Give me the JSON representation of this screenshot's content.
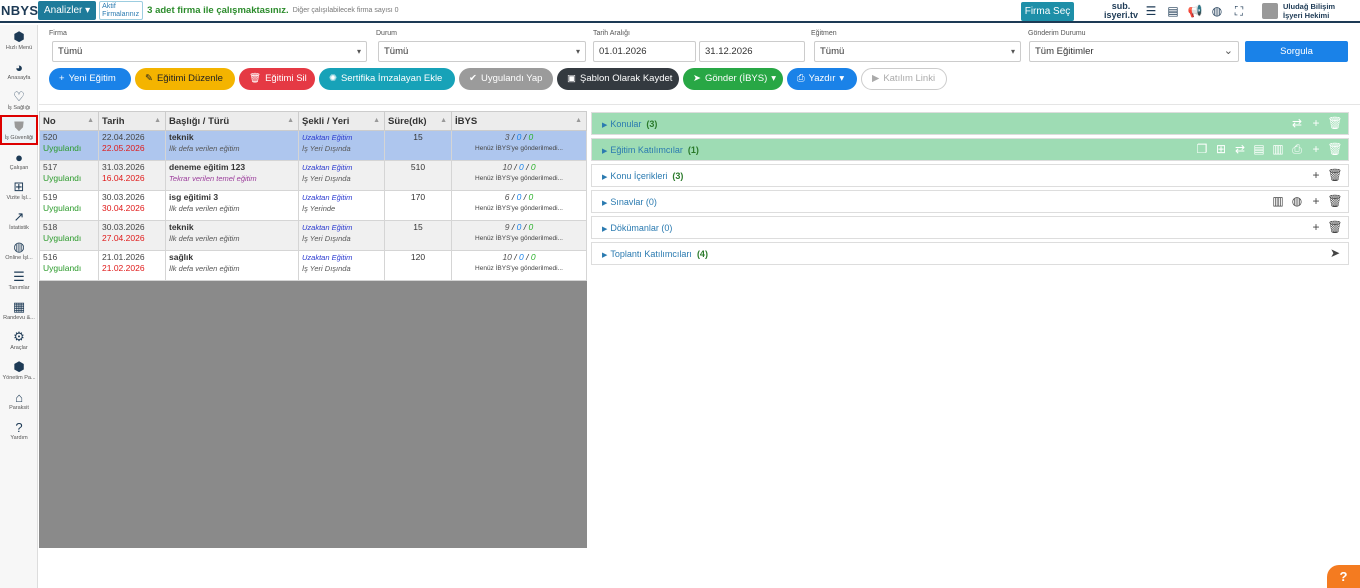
{
  "topbar": {
    "logo": "NBYS",
    "analiz_label": "Analizler",
    "aktif_label": "Aktif Firmalarınız",
    "firm_msg": "3 adet firma ile çalışmaktasınız.",
    "firm_msg2": "Diğer çalışılabilecek firma sayısı 0",
    "firma_sec": "Firma Seç",
    "sub_logo": "sub. isyeri.tv",
    "user_name": "Uludağ Bilişim",
    "user_role": "İşyeri Hekimi"
  },
  "sidebar": {
    "items": [
      {
        "label": "Hızlı Menü",
        "icon": "boxes-icon"
      },
      {
        "label": "Anasayfa",
        "icon": "pie-chart-icon"
      },
      {
        "label": "İş Sağlığı",
        "icon": "heartbeat-icon"
      },
      {
        "label": "İş Güvenliği",
        "icon": "shield-icon"
      },
      {
        "label": "Çalışan",
        "icon": "person-icon"
      },
      {
        "label": "Vizite İşl...",
        "icon": "medical-case-icon"
      },
      {
        "label": "İstatistik",
        "icon": "line-chart-icon"
      },
      {
        "label": "Online İşl...",
        "icon": "globe-icon"
      },
      {
        "label": "Tanımlar",
        "icon": "sliders-icon"
      },
      {
        "label": "Randevu &...",
        "icon": "calendar-icon"
      },
      {
        "label": "Araçlar",
        "icon": "gears-icon"
      },
      {
        "label": "Yönetim Pa...",
        "icon": "boxes-icon"
      },
      {
        "label": "Paraksit",
        "icon": "bank-icon"
      },
      {
        "label": "Yardım",
        "icon": "question-icon"
      }
    ]
  },
  "filters": {
    "firma_label": "Firma",
    "firma_value": "Tümü",
    "durum_label": "Durum",
    "durum_value": "Tümü",
    "tarih_label": "Tarih Aralığı",
    "tarih_start": "01.01.2026",
    "tarih_end": "31.12.2026",
    "egitmen_label": "Eğitmen",
    "egitmen_value": "Tümü",
    "gonderim_label": "Gönderim Durumu",
    "gonderim_value": "Tüm Eğitimler",
    "sorgula": "Sorgula"
  },
  "buttons": {
    "yeni": "Yeni Eğitim",
    "duzenle": "Eğitimi Düzenle",
    "sil": "Eğitimi Sil",
    "sertifika": "Sertifika İmzalayan Ekle",
    "uygulandi": "Uygulandı Yap",
    "sablon": "Şablon Olarak Kaydet",
    "gonder": "Gönder (İBYS)",
    "yazdir": "Yazdır",
    "katilim": "Katılım Linki"
  },
  "table": {
    "headers": [
      "No",
      "Tarih",
      "Başlığı / Türü",
      "Şekli / Yeri",
      "Süre(dk)",
      "İBYS"
    ],
    "rows": [
      {
        "no": "520",
        "status": "Uygulandı",
        "d1": "22.04.2026",
        "d2": "22.05.2026",
        "title": "teknik",
        "type": "İlk defa verilen eğitim",
        "sekil": "Uzaktan Eğitim",
        "yer": "İş Yeri Dışında",
        "sure": "15",
        "i1": "3",
        "i2": "0",
        "i3": "0",
        "ibys_note": "Henüz İBYS'ye gönderilmedi..."
      },
      {
        "no": "517",
        "status": "Uygulandı",
        "d1": "31.03.2026",
        "d2": "16.04.2026",
        "title": "deneme eğitim 123",
        "type": "Tekrar verilen temel eğitim",
        "sekil": "Uzaktan Eğitim",
        "yer": "İş Yeri Dışında",
        "sure": "510",
        "i1": "10",
        "i2": "0",
        "i3": "0",
        "ibys_note": "Henüz İBYS'ye gönderilmedi..."
      },
      {
        "no": "519",
        "status": "Uygulandı",
        "d1": "30.03.2026",
        "d2": "30.04.2026",
        "title": "isg eğitimi 3",
        "type": "İlk defa verilen eğitim",
        "sekil": "Uzaktan Eğitim",
        "yer": "İş Yerinde",
        "sure": "170",
        "i1": "6",
        "i2": "0",
        "i3": "0",
        "ibys_note": "Henüz İBYS'ye gönderilmedi..."
      },
      {
        "no": "518",
        "status": "Uygulandı",
        "d1": "30.03.2026",
        "d2": "27.04.2026",
        "title": "teknik",
        "type": "İlk defa verilen eğitim",
        "sekil": "Uzaktan Eğitim",
        "yer": "İş Yeri Dışında",
        "sure": "15",
        "i1": "9",
        "i2": "0",
        "i3": "0",
        "ibys_note": "Henüz İBYS'ye gönderilmedi..."
      },
      {
        "no": "516",
        "status": "Uygulandı",
        "d1": "21.01.2026",
        "d2": "21.02.2026",
        "title": "sağlık",
        "type": "İlk defa verilen eğitim",
        "sekil": "Uzaktan Eğitim",
        "yer": "İş Yeri Dışında",
        "sure": "120",
        "i1": "10",
        "i2": "0",
        "i3": "0",
        "ibys_note": "Henüz İBYS'ye gönderilmedi..."
      }
    ]
  },
  "panels": [
    {
      "label": "Konular",
      "count": "(3)"
    },
    {
      "label": "Eğitim Katılımcılar",
      "count": "(1)"
    },
    {
      "label": "Konu İçerikleri",
      "count": "(3)"
    },
    {
      "label": "Sınavlar (0)",
      "count": ""
    },
    {
      "label": "Dökümanlar (0)",
      "count": ""
    },
    {
      "label": "Toplantı Katılımcıları",
      "count": "(4)"
    }
  ],
  "help_label": "?"
}
